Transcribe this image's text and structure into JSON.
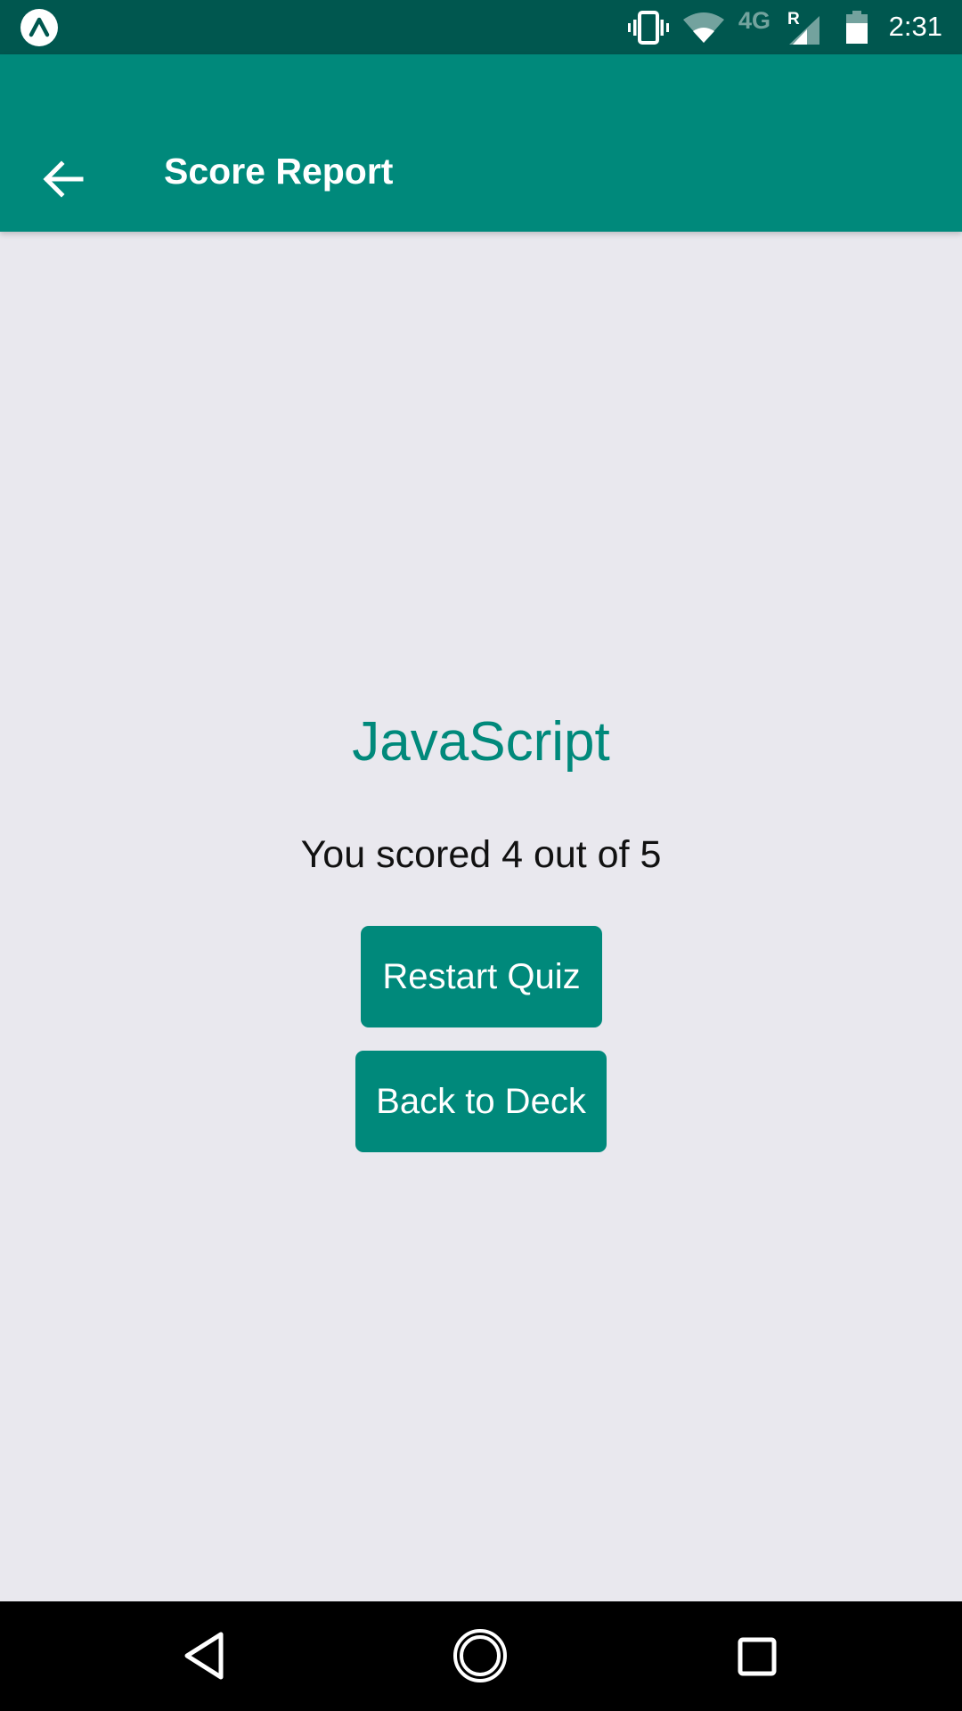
{
  "status_bar": {
    "time": "2:31",
    "network_label": "4G",
    "roaming_label": "R",
    "icons": [
      "expo-logo-icon",
      "vibrate-icon",
      "wifi-icon",
      "signal-icon",
      "battery-icon"
    ]
  },
  "app_bar": {
    "title": "Score Report",
    "back_icon": "arrow-back-icon"
  },
  "main": {
    "deck_title": "JavaScript",
    "score_text": "You scored 4 out of 5",
    "restart_label": "Restart Quiz",
    "back_to_deck_label": "Back to Deck"
  },
  "nav_bar": {
    "icons": [
      "nav-back-icon",
      "nav-home-icon",
      "nav-recents-icon"
    ]
  },
  "colors": {
    "status_bar": "#00574f",
    "primary": "#00897b",
    "background": "#e9e8ee",
    "nav_bar": "#000000"
  }
}
